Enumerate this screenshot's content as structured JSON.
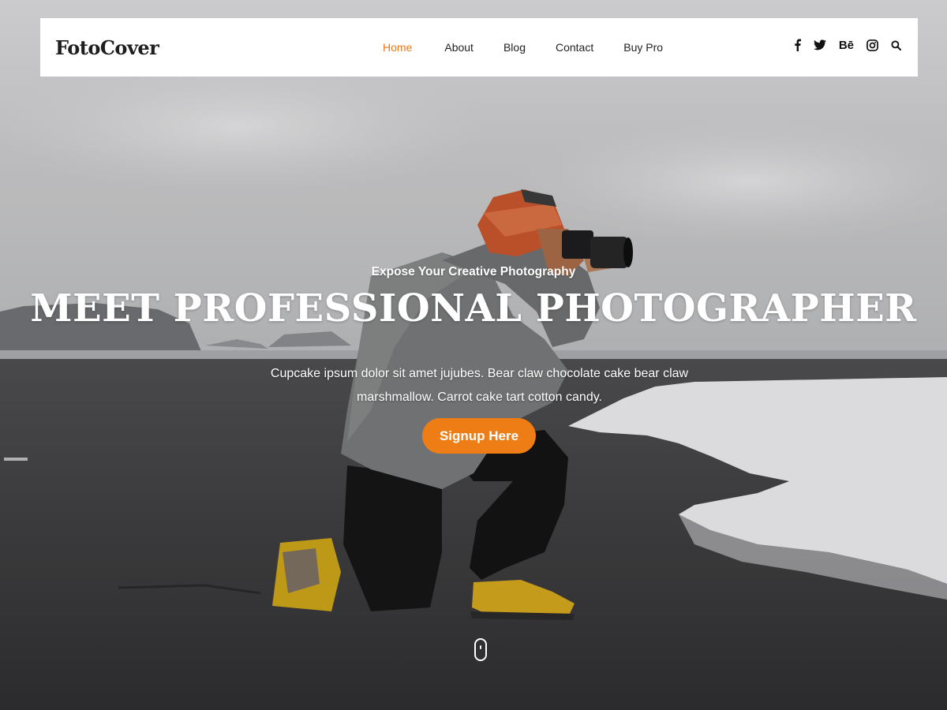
{
  "site": {
    "logo": "FotoCover"
  },
  "nav": {
    "items": [
      {
        "label": "Home",
        "active": true
      },
      {
        "label": "About",
        "active": false
      },
      {
        "label": "Blog",
        "active": false
      },
      {
        "label": "Contact",
        "active": false
      },
      {
        "label": "Buy Pro",
        "active": false
      }
    ]
  },
  "social": {
    "icons": [
      "facebook-icon",
      "twitter-icon",
      "behance-icon",
      "instagram-icon",
      "search-icon"
    ],
    "behance_text": "Bē"
  },
  "hero": {
    "tagline": "Expose Your Creative Photography",
    "title": "MEET PROFESSIONAL PHOTOGRAPHER",
    "description": "Cupcake ipsum dolor sit amet jujubes. Bear claw chocolate cake bear claw marshmallow. Carrot cake tart cotton candy.",
    "cta_label": "Signup Here"
  },
  "colors": {
    "accent": "#ee7d16",
    "nav_active": "#e8781a",
    "text_dark": "#222222",
    "header_bg": "#ffffff"
  }
}
